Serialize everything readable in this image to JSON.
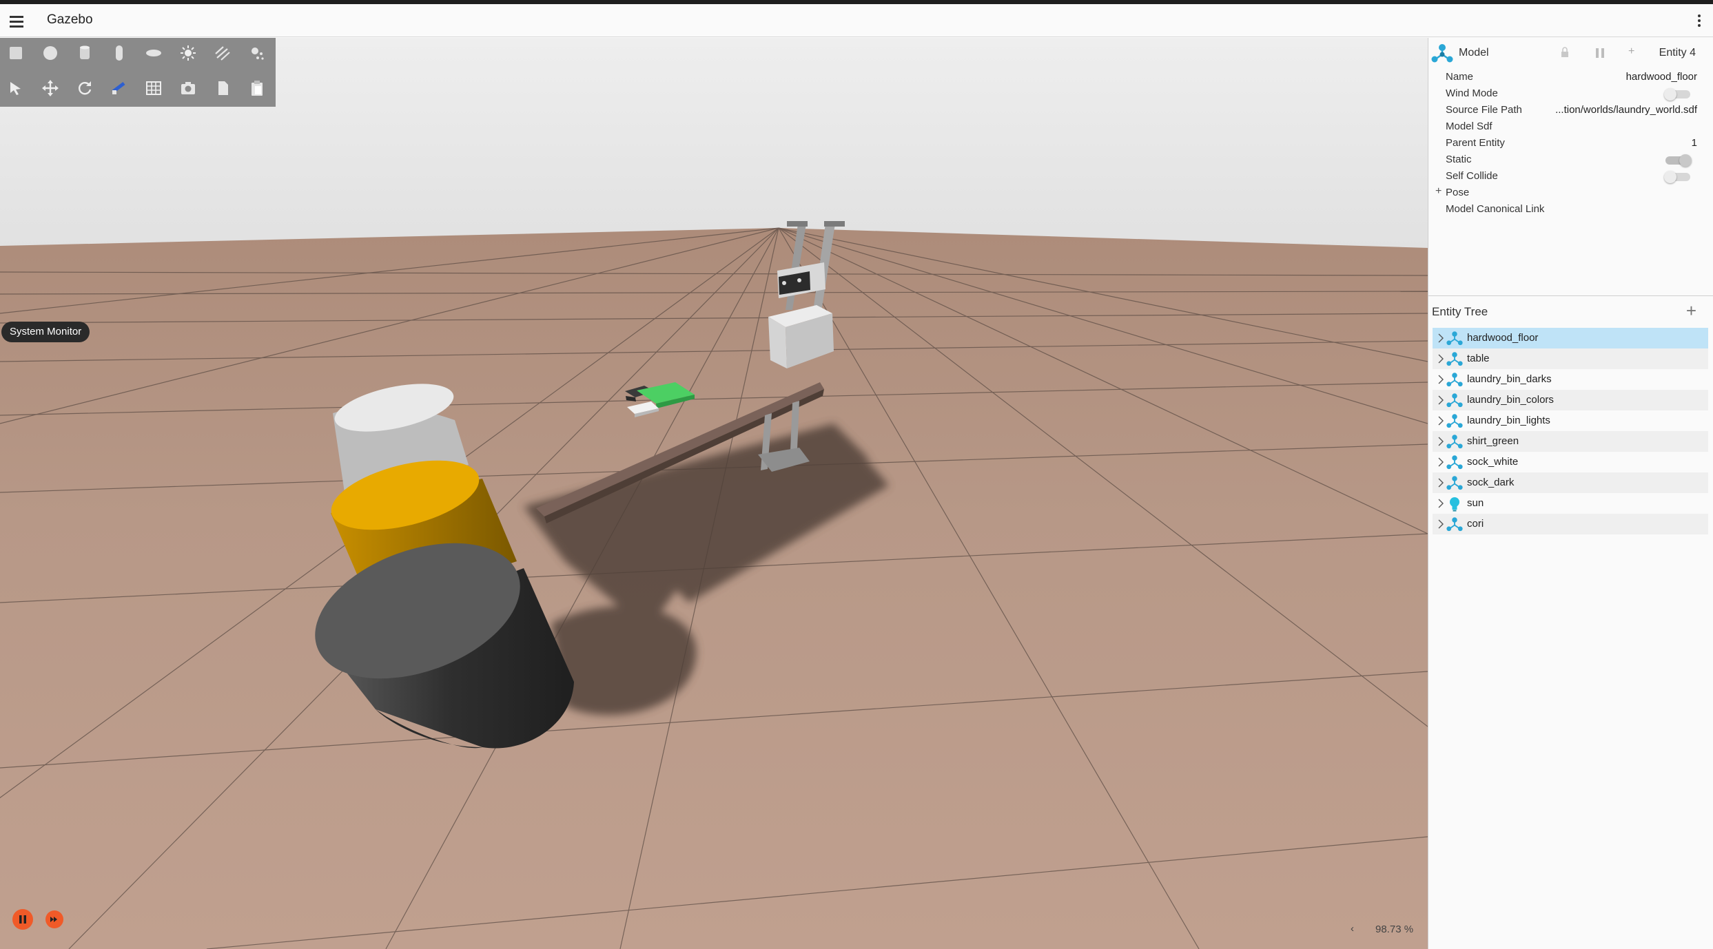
{
  "app": {
    "title": "Gazebo"
  },
  "toolbar": {
    "shape_tools": [
      "box-icon",
      "sphere-icon",
      "cylinder-icon",
      "capsule-icon",
      "ellipsoid-icon",
      "sun-icon",
      "directional-light-icon",
      "spot-light-icon"
    ],
    "transform_tools": [
      "select-icon",
      "translate-icon",
      "rotate-icon",
      "snap-icon",
      "grid-icon",
      "screenshot-icon",
      "copy-icon",
      "paste-icon"
    ]
  },
  "overlay": {
    "system_monitor": "System Monitor",
    "real_time_factor": "98.73 %",
    "rtf_arrow": "‹"
  },
  "component_inspector": {
    "type": "Model",
    "entity": "Entity 4",
    "properties": [
      {
        "label": "Name",
        "value": "hardwood_floor"
      },
      {
        "label": "Wind Mode",
        "toggle": "off"
      },
      {
        "label": "Source File Path",
        "value": "...tion/worlds/laundry_world.sdf"
      },
      {
        "label": "Model Sdf",
        "value": ""
      },
      {
        "label": "Parent Entity",
        "value": "1"
      },
      {
        "label": "Static",
        "toggle": "on"
      },
      {
        "label": "Self Collide",
        "toggle": "off"
      },
      {
        "label": "Pose",
        "value": ""
      },
      {
        "label": "Model Canonical Link",
        "value": ""
      }
    ],
    "pose_expand": "+"
  },
  "entity_tree": {
    "title": "Entity Tree",
    "add": "+",
    "items": [
      {
        "label": "hardwood_floor",
        "icon": "model-icon",
        "selected": true
      },
      {
        "label": "table",
        "icon": "model-icon"
      },
      {
        "label": "laundry_bin_darks",
        "icon": "model-icon"
      },
      {
        "label": "laundry_bin_colors",
        "icon": "model-icon"
      },
      {
        "label": "laundry_bin_lights",
        "icon": "model-icon"
      },
      {
        "label": "shirt_green",
        "icon": "model-icon"
      },
      {
        "label": "sock_white",
        "icon": "model-icon"
      },
      {
        "label": "sock_dark",
        "icon": "model-icon"
      },
      {
        "label": "sun",
        "icon": "light-icon"
      },
      {
        "label": "cori",
        "icon": "model-icon"
      }
    ]
  },
  "colors": {
    "accent": "#f05a28",
    "selection": "#bfe3f7",
    "model_icon": "#2aa7d6",
    "floor": "#bd9e8c",
    "sky": "#e7e7e7",
    "bin_lights": "#e6e6e6",
    "bin_colors": "#e8aa00",
    "bin_darks": "#4a4a4a",
    "shirt": "#4ccf63"
  }
}
